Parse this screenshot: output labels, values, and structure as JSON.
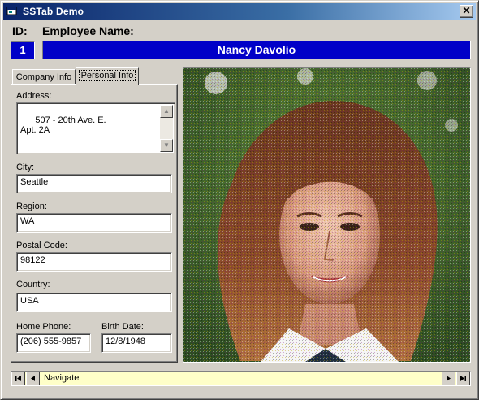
{
  "window": {
    "title": "SSTab Demo",
    "close_label": "✕"
  },
  "header": {
    "id_label": "ID:",
    "name_label": "Employee Name:",
    "id_value": "1",
    "name_value": "Nancy Davolio"
  },
  "tabs": [
    {
      "label": "Company Info",
      "selected": false
    },
    {
      "label": "Personal Info",
      "selected": true
    }
  ],
  "personal": {
    "address_label": "Address:",
    "address_value": "507 - 20th Ave. E.\nApt. 2A",
    "city_label": "City:",
    "city_value": "Seattle",
    "region_label": "Region:",
    "region_value": "WA",
    "postal_label": "Postal Code:",
    "postal_value": "98122",
    "country_label": "Country:",
    "country_value": "USA",
    "phone_label": "Home Phone:",
    "phone_value": "(206) 555-9857",
    "birth_label": "Birth Date:",
    "birth_value": "12/8/1948"
  },
  "navigator": {
    "caption": "Navigate",
    "buttons": [
      "first-record-icon",
      "previous-record-icon",
      "next-record-icon",
      "last-record-icon"
    ]
  },
  "colors": {
    "title_bar": "#0a246a",
    "header_fill": "#0000c8",
    "navigator_fill": "#ffffc8",
    "face": "#d4d0c8"
  }
}
